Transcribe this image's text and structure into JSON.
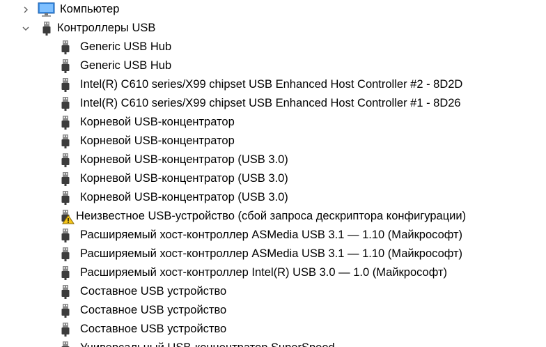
{
  "tree": {
    "computer": {
      "label": "Компьютер",
      "icon": "monitor-icon",
      "expanded": false
    },
    "usb_controllers": {
      "label": "Контроллеры USB",
      "icon": "usb-plug-icon",
      "expanded": true,
      "items": [
        {
          "label": "Generic USB Hub",
          "icon": "usb-plug-icon"
        },
        {
          "label": "Generic USB Hub",
          "icon": "usb-plug-icon"
        },
        {
          "label": "Intel(R) C610 series/X99 chipset USB Enhanced Host Controller #2 - 8D2D",
          "icon": "usb-plug-icon"
        },
        {
          "label": "Intel(R) C610 series/X99 chipset USB Enhanced Host Controller #1 - 8D26",
          "icon": "usb-plug-icon"
        },
        {
          "label": "Корневой USB-концентратор",
          "icon": "usb-plug-icon"
        },
        {
          "label": "Корневой USB-концентратор",
          "icon": "usb-plug-icon"
        },
        {
          "label": "Корневой USB-концентратор (USB 3.0)",
          "icon": "usb-plug-icon"
        },
        {
          "label": "Корневой USB-концентратор (USB 3.0)",
          "icon": "usb-plug-icon"
        },
        {
          "label": "Корневой USB-концентратор (USB 3.0)",
          "icon": "usb-plug-icon"
        },
        {
          "label": "Неизвестное USB-устройство (сбой запроса дескриптора конфигурации)",
          "icon": "usb-warning-icon"
        },
        {
          "label": "Расширяемый хост-контроллер ASMedia USB 3.1 — 1.10 (Майкрософт)",
          "icon": "usb-plug-icon"
        },
        {
          "label": "Расширяемый хост-контроллер ASMedia USB 3.1 — 1.10 (Майкрософт)",
          "icon": "usb-plug-icon"
        },
        {
          "label": "Расширяемый хост-контроллер Intel(R) USB 3.0 — 1.0 (Майкрософт)",
          "icon": "usb-plug-icon"
        },
        {
          "label": "Составное USB устройство",
          "icon": "usb-plug-icon"
        },
        {
          "label": "Составное USB устройство",
          "icon": "usb-plug-icon"
        },
        {
          "label": "Составное USB устройство",
          "icon": "usb-plug-icon"
        },
        {
          "label": "Универсальный USB-концентратор SuperSpeed",
          "icon": "usb-plug-icon"
        }
      ]
    }
  },
  "colors": {
    "chevron": "#5f5f5f",
    "plug_dark": "#3c3c3c",
    "plug_light": "#8a8a8a",
    "warning_yellow": "#f5c518",
    "warning_border": "#8a6a00",
    "monitor_blue": "#3a8ee6"
  }
}
